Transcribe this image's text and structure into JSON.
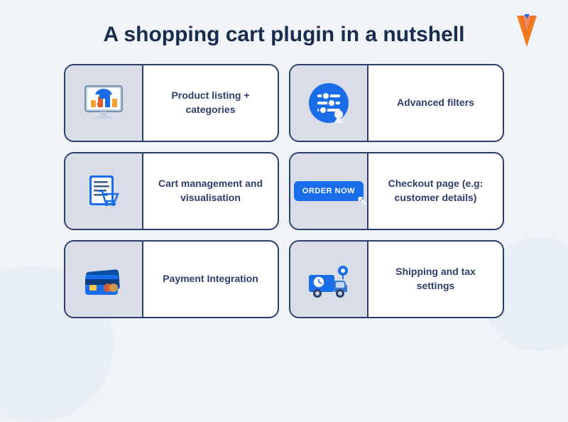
{
  "page": {
    "title": "A shopping cart plugin in a nutshell",
    "bg_color": "#f0f4f8"
  },
  "logo": {
    "alt": "W logo"
  },
  "cards": [
    {
      "id": "product-listing",
      "label": "Product listing + categories",
      "icon": "product-listing-icon"
    },
    {
      "id": "advanced-filters",
      "label": "Advanced filters",
      "icon": "advanced-filters-icon"
    },
    {
      "id": "cart-management",
      "label": "Cart management and visualisation",
      "icon": "cart-icon"
    },
    {
      "id": "checkout",
      "label": "Checkout page (e.g: customer details)",
      "icon": "order-now-icon"
    },
    {
      "id": "payment-integration",
      "label": "Payment Integration",
      "icon": "payment-icon"
    },
    {
      "id": "shipping-tax",
      "label": "Shipping and tax settings",
      "icon": "shipping-icon"
    }
  ]
}
